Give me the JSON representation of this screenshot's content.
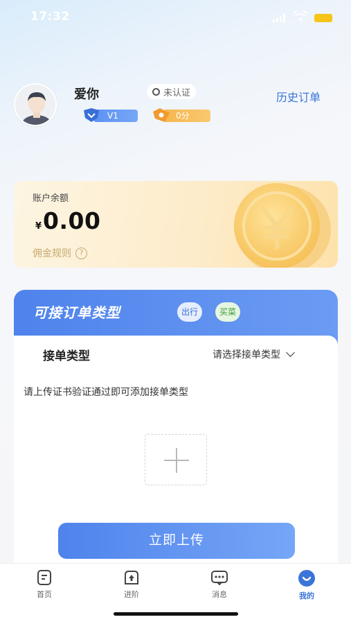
{
  "status_bar": {
    "time": "17:32"
  },
  "profile": {
    "username": "爱你",
    "cert_status": "未认证",
    "level": "V1",
    "score": "0分",
    "history_link": "历史订单"
  },
  "balance": {
    "label": "账户余额",
    "currency": "¥",
    "amount": "0.00",
    "commission_rules": "佣金规则"
  },
  "order_types": {
    "title": "可接订单类型",
    "chips": [
      "出行",
      "买菜"
    ],
    "type_label": "接单类型",
    "select_placeholder": "请选择接单类型",
    "hint": "请上传证书验证通过即可添加接单类型",
    "upload_button": "立即上传"
  },
  "tab_bar": {
    "tabs": [
      {
        "label": "首页",
        "icon": "home-icon"
      },
      {
        "label": "进阶",
        "icon": "upgrade-icon"
      },
      {
        "label": "消息",
        "icon": "message-icon"
      },
      {
        "label": "我的",
        "icon": "profile-icon",
        "active": true
      }
    ]
  },
  "colors": {
    "accent": "#3a74d8",
    "brand_blue": "#4f83ec",
    "gold": "#f5c35a"
  }
}
